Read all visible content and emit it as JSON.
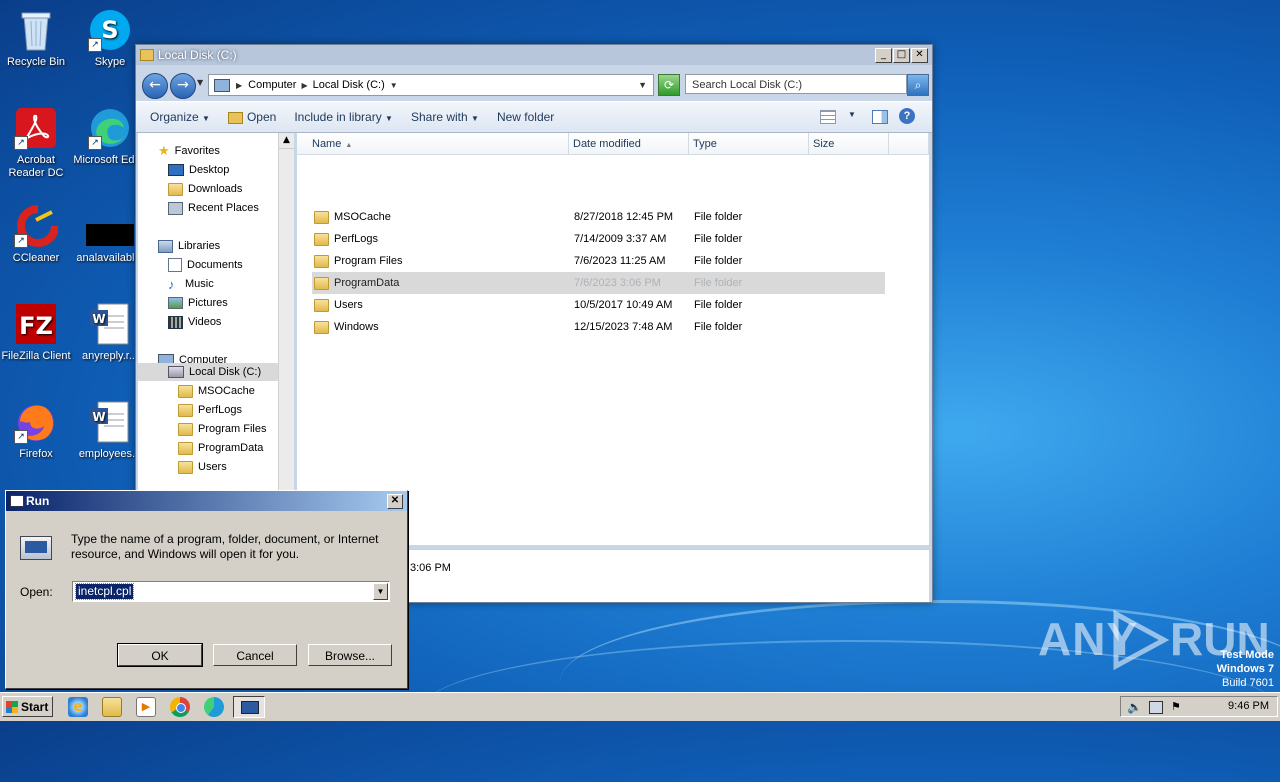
{
  "desktop": {
    "icons": [
      {
        "label": "Recycle Bin"
      },
      {
        "label": "Skype"
      },
      {
        "label": "Acrobat Reader DC"
      },
      {
        "label": "Microsoft Edge"
      },
      {
        "label": "CCleaner"
      },
      {
        "label": "analavailabl..."
      },
      {
        "label": "FileZilla Client"
      },
      {
        "label": "anyreply.r..."
      },
      {
        "label": "Firefox"
      },
      {
        "label": "employees..."
      }
    ],
    "watermark": {
      "brand": "ANY",
      "brand2": "RUN",
      "mode_line1": "Test Mode",
      "mode_line2": "Windows 7",
      "mode_line3": "Build 7601"
    }
  },
  "explorer": {
    "title": "Local Disk (C:)",
    "breadcrumb": [
      "Computer",
      "Local Disk (C:)"
    ],
    "search_placeholder": "Search Local Disk (C:)",
    "toolbar": {
      "organize": "Organize",
      "open": "Open",
      "include_in_library": "Include in library",
      "share_with": "Share with",
      "new_folder": "New folder"
    },
    "nav": {
      "favorites": "Favorites",
      "desktop": "Desktop",
      "downloads": "Downloads",
      "recent_places": "Recent Places",
      "libraries": "Libraries",
      "documents": "Documents",
      "music": "Music",
      "pictures": "Pictures",
      "videos": "Videos",
      "computer": "Computer",
      "local_disk": "Local Disk (C:)",
      "sub": [
        "MSOCache",
        "PerfLogs",
        "Program Files",
        "ProgramData",
        "Users"
      ]
    },
    "columns": {
      "name": "Name",
      "date": "Date modified",
      "type": "Type",
      "size": "Size"
    },
    "rows": [
      {
        "name": "MSOCache",
        "date": "8/27/2018 12:45 PM",
        "type": "File folder"
      },
      {
        "name": "PerfLogs",
        "date": "7/14/2009 3:37 AM",
        "type": "File folder"
      },
      {
        "name": "Program Files",
        "date": "7/6/2023 11:25 AM",
        "type": "File folder"
      },
      {
        "name": "ProgramData",
        "date": "7/6/2023 3:06 PM",
        "type": "File folder"
      },
      {
        "name": "Users",
        "date": "10/5/2017 10:49 AM",
        "type": "File folder"
      },
      {
        "name": "Windows",
        "date": "12/15/2023 7:48 AM",
        "type": "File folder"
      }
    ],
    "details_text": "3:06 PM"
  },
  "run": {
    "title": "Run",
    "description": "Type the name of a program, folder, document, or Internet resource, and Windows will open it for you.",
    "open_label": "Open:",
    "value": "inetcpl.cpl",
    "ok": "OK",
    "cancel": "Cancel",
    "browse": "Browse..."
  },
  "taskbar": {
    "start": "Start",
    "clock": "9:46 PM"
  }
}
